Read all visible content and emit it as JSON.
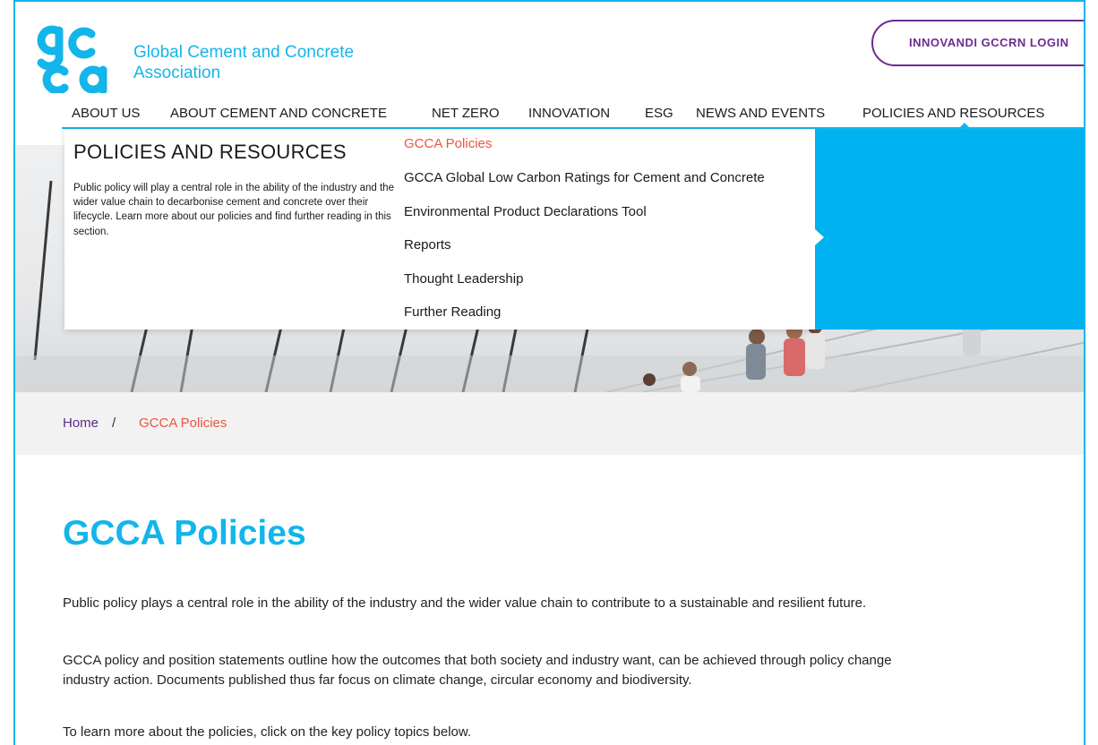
{
  "brand": {
    "name_line1": "Global Cement and Concrete",
    "name_line2": "Association",
    "accent": "#13b5ea",
    "purple": "#6b2d8e",
    "orange": "#e8563f"
  },
  "header": {
    "login_label": "INNOVANDI GCCRN LOGIN"
  },
  "nav": {
    "items": [
      "ABOUT US",
      "ABOUT CEMENT AND CONCRETE",
      "NET ZERO",
      "INNOVATION",
      "ESG",
      "NEWS AND EVENTS",
      "POLICIES AND RESOURCES"
    ],
    "active_index": 6
  },
  "dropdown": {
    "title": "POLICIES AND RESOURCES",
    "description": "Public policy will play a central role in the ability of the industry and the wider value chain to decarbonise cement and concrete over their lifecycle. Learn more about our policies and find further reading in this section.",
    "links": [
      "GCCA Policies",
      "GCCA Global Low Carbon Ratings for Cement and Concrete",
      "Environmental Product Declarations Tool",
      "Reports",
      "Thought Leadership",
      "Further Reading"
    ],
    "active_link": 0
  },
  "breadcrumb": {
    "home": "Home",
    "separator": "/",
    "current": "GCCA Policies"
  },
  "main": {
    "title": "GCCA Policies",
    "paragraph1": "Public policy plays a central role in the ability of the industry and the wider value chain to contribute to a sustainable and resilient future.",
    "paragraph2_line1": "GCCA policy and position statements outline how the outcomes that both society and industry want, can be achieved through policy change",
    "paragraph2_line2": "industry action.  Documents published thus far focus on climate change, circular economy and biodiversity.",
    "paragraph3": "To learn more about the policies, click on the key policy topics below."
  }
}
